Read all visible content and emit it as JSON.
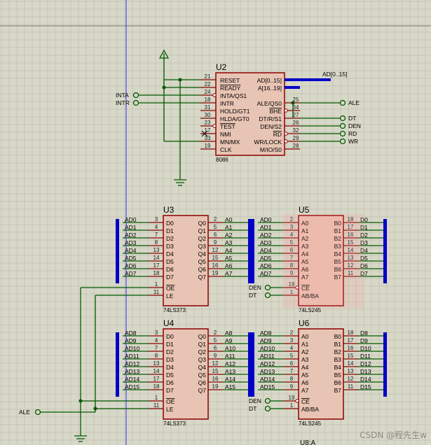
{
  "colors": {
    "grid": "#c6c6b6",
    "bg": "#d8d8c8",
    "wire": "#005a00",
    "body": "#e8c4b4",
    "border": "#8b0000",
    "bus": "#0000c8",
    "pinNum": "#202020",
    "label": "#000000"
  },
  "watermark": "CSDN @程先生w",
  "offscreen_label": "U8:A",
  "u2": {
    "ref": "U2",
    "part": "8086",
    "left": [
      {
        "n": "21",
        "t": "RESET"
      },
      {
        "n": "22",
        "t": "READY"
      },
      {
        "n": "24",
        "t": "INTA/QS1"
      },
      {
        "n": "18",
        "t": "INTR"
      },
      {
        "n": "31",
        "t": "HOLD/GT1"
      },
      {
        "n": "30",
        "t": "HLDA/GT0"
      },
      {
        "n": "23",
        "t": "TEST"
      },
      {
        "n": "17",
        "t": "NMI"
      },
      {
        "n": "33",
        "t": "MN/MX"
      },
      {
        "n": "19",
        "t": "CLK"
      }
    ],
    "right": [
      {
        "n": "",
        "t": "AD[0..15]"
      },
      {
        "n": "",
        "t": "A[16..19]"
      },
      {
        "n": "25",
        "t": "ALE/QS0"
      },
      {
        "n": "34",
        "t": "BHE"
      },
      {
        "n": "27",
        "t": "DT/R/S1"
      },
      {
        "n": "26",
        "t": "DEN/S2"
      },
      {
        "n": "32",
        "t": "RD"
      },
      {
        "n": "29",
        "t": "WR/LOCK"
      },
      {
        "n": "28",
        "t": "M/IO/S0"
      }
    ],
    "bus_label": "AD[0..15]"
  },
  "terminals": {
    "inta": "INTA",
    "intr": "INTR",
    "ale_out": "ALE",
    "dt": "DT",
    "den": "DEN",
    "rd": "RD",
    "wr": "WR",
    "ale_in": "ALE"
  },
  "u3": {
    "ref": "U3",
    "part": "74LS373",
    "ins": [
      "D0",
      "D1",
      "D2",
      "D3",
      "D4",
      "D5",
      "D6",
      "D7"
    ],
    "outs": [
      "Q0",
      "Q1",
      "Q2",
      "Q3",
      "Q4",
      "Q5",
      "Q6",
      "Q7"
    ],
    "in_pins": [
      "3",
      "4",
      "7",
      "8",
      "13",
      "14",
      "17",
      "18"
    ],
    "out_pins": [
      "2",
      "5",
      "6",
      "9",
      "12",
      "15",
      "16",
      "19"
    ],
    "in_nets": [
      "AD0",
      "AD1",
      "AD2",
      "AD3",
      "AD4",
      "AD5",
      "AD6",
      "AD7"
    ],
    "out_nets": [
      "A0",
      "A1",
      "A2",
      "A3",
      "A4",
      "A5",
      "A6",
      "A7"
    ],
    "oe_pin": "1",
    "le_pin": "11",
    "oe": "OE",
    "le": "LE"
  },
  "u4": {
    "ref": "U4",
    "part": "74LS373",
    "ins": [
      "D0",
      "D1",
      "D2",
      "D3",
      "D4",
      "D5",
      "D6",
      "D7"
    ],
    "outs": [
      "Q0",
      "Q1",
      "Q2",
      "Q3",
      "Q4",
      "Q5",
      "Q6",
      "Q7"
    ],
    "in_pins": [
      "3",
      "4",
      "7",
      "8",
      "13",
      "14",
      "17",
      "18"
    ],
    "out_pins": [
      "2",
      "5",
      "6",
      "9",
      "12",
      "15",
      "16",
      "19"
    ],
    "in_nets": [
      "AD8",
      "AD9",
      "AD10",
      "AD11",
      "AD12",
      "AD13",
      "AD14",
      "AD15"
    ],
    "out_nets": [
      "A8",
      "A9",
      "A10",
      "A11",
      "A12",
      "A13",
      "A14",
      "A15"
    ],
    "oe_pin": "1",
    "le_pin": "11",
    "oe": "OE",
    "le": "LE"
  },
  "u5": {
    "ref": "U5",
    "part": "74LS245",
    "ins": [
      "A0",
      "A1",
      "A2",
      "A3",
      "A4",
      "A5",
      "A6",
      "A7"
    ],
    "outs": [
      "B0",
      "B1",
      "B2",
      "B3",
      "B4",
      "B5",
      "B6",
      "B7"
    ],
    "in_pins": [
      "2",
      "3",
      "4",
      "5",
      "6",
      "7",
      "8",
      "9"
    ],
    "out_pins": [
      "18",
      "17",
      "16",
      "15",
      "14",
      "13",
      "12",
      "11"
    ],
    "in_nets": [
      "AD0",
      "AD1",
      "AD2",
      "AD3",
      "AD4",
      "AD5",
      "AD6",
      "AD7"
    ],
    "out_nets": [
      "D0",
      "D1",
      "D2",
      "D3",
      "D4",
      "D5",
      "D6",
      "D7"
    ],
    "ce_pin": "19",
    "ab_pin": "1",
    "ce": "CE",
    "ab": "AB/BA",
    "ce_net": "DEN",
    "ab_net": "DT"
  },
  "u6": {
    "ref": "U6",
    "part": "74LS245",
    "ins": [
      "A0",
      "A1",
      "A2",
      "A3",
      "A4",
      "A5",
      "A6",
      "A7"
    ],
    "outs": [
      "B0",
      "B1",
      "B2",
      "B3",
      "B4",
      "B5",
      "B6",
      "B7"
    ],
    "in_pins": [
      "2",
      "3",
      "4",
      "5",
      "6",
      "7",
      "8",
      "9"
    ],
    "out_pins": [
      "18",
      "17",
      "16",
      "15",
      "14",
      "13",
      "12",
      "11"
    ],
    "in_nets": [
      "AD8",
      "AD9",
      "AD10",
      "AD11",
      "AD12",
      "AD13",
      "AD14",
      "AD15"
    ],
    "out_nets": [
      "D8",
      "D9",
      "D10",
      "D11",
      "D12",
      "D13",
      "D14",
      "D15"
    ],
    "ce_pin": "19",
    "ab_pin": "1",
    "ce": "CE",
    "ab": "AB/BA",
    "ce_net": "DEN",
    "ab_net": "DT"
  }
}
